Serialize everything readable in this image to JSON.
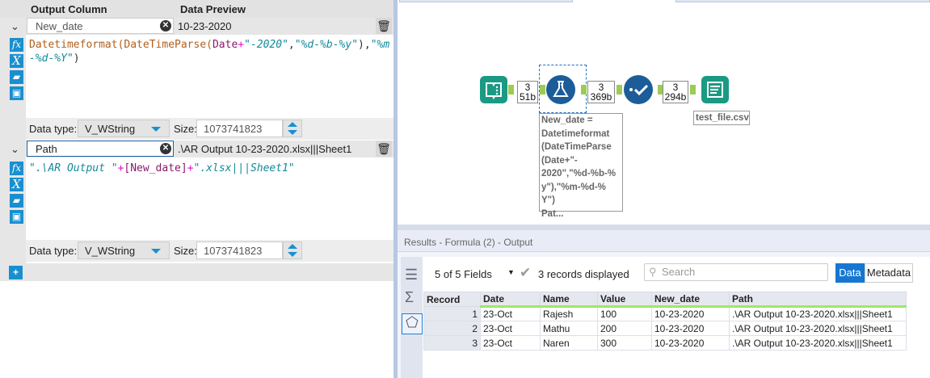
{
  "formula_panel": {
    "headers": {
      "output_column": "Output Column",
      "data_preview": "Data Preview"
    },
    "fields": [
      {
        "name": "New_date",
        "preview": "10-23-2020",
        "expression": [
          [
            "fn",
            "Datetimeformat("
          ],
          [
            "fn",
            "DateTimeParse("
          ],
          [
            "fld",
            "Date"
          ],
          [
            "op",
            "+"
          ],
          [
            "str",
            "\"-2020\""
          ],
          [
            "pl",
            ","
          ],
          [
            "str",
            "\"%d-%b-%y\""
          ],
          [
            "pl",
            "),"
          ],
          [
            "str",
            "\"%m-%d-%Y\""
          ],
          [
            "pl",
            ")"
          ]
        ],
        "data_type_label": "Data type:",
        "data_type": "V_WString",
        "size_label": "Size:",
        "size": "1073741823"
      },
      {
        "name": "Path",
        "preview": ".\\AR Output 10-23-2020.xlsx|||Sheet1",
        "expression": [
          [
            "str",
            "\".\\AR Output \""
          ],
          [
            "op",
            "+"
          ],
          [
            "fld",
            "[New_date]"
          ],
          [
            "op",
            "+"
          ],
          [
            "str",
            "\".xlsx|||Sheet1\""
          ]
        ],
        "data_type_label": "Data type:",
        "data_type": "V_WString",
        "size_label": "Size:",
        "size": "1073741823"
      }
    ],
    "add_button": "+"
  },
  "canvas": {
    "connections": [
      {
        "count": "3",
        "size": "51b"
      },
      {
        "count": "3",
        "size": "369b"
      },
      {
        "count": "3",
        "size": "294b"
      }
    ],
    "formula_annotation": [
      "New_date =",
      "Datetimeformat",
      "(DateTimeParse",
      "(Date+\"-",
      "2020\",\"%d-%b-%",
      "y\"),\"%m-%d-%",
      "Y\")",
      "Pat..."
    ],
    "output_annotation": "test_file.csv",
    "colors": {
      "input": "#1a9a84",
      "formula": "#1c5d99",
      "select": "#1c5d99",
      "output": "#1a9a84"
    }
  },
  "results": {
    "title": "Results - Formula (2) - Output",
    "fields_selector": "5 of 5 Fields",
    "records_displayed": "3 records displayed",
    "search_placeholder": "Search",
    "data_button": "Data",
    "metadata_button": "Metadata",
    "columns": [
      "Record",
      "Date",
      "Name",
      "Value",
      "New_date",
      "Path"
    ],
    "rows": [
      [
        "1",
        "23-Oct",
        "Rajesh",
        "100",
        "10-23-2020",
        ".\\AR Output 10-23-2020.xlsx|||Sheet1"
      ],
      [
        "2",
        "23-Oct",
        "Mathu",
        "200",
        "10-23-2020",
        ".\\AR Output 10-23-2020.xlsx|||Sheet1"
      ],
      [
        "3",
        "23-Oct",
        "Naren",
        "300",
        "10-23-2020",
        ".\\AR Output 10-23-2020.xlsx|||Sheet1"
      ]
    ]
  }
}
